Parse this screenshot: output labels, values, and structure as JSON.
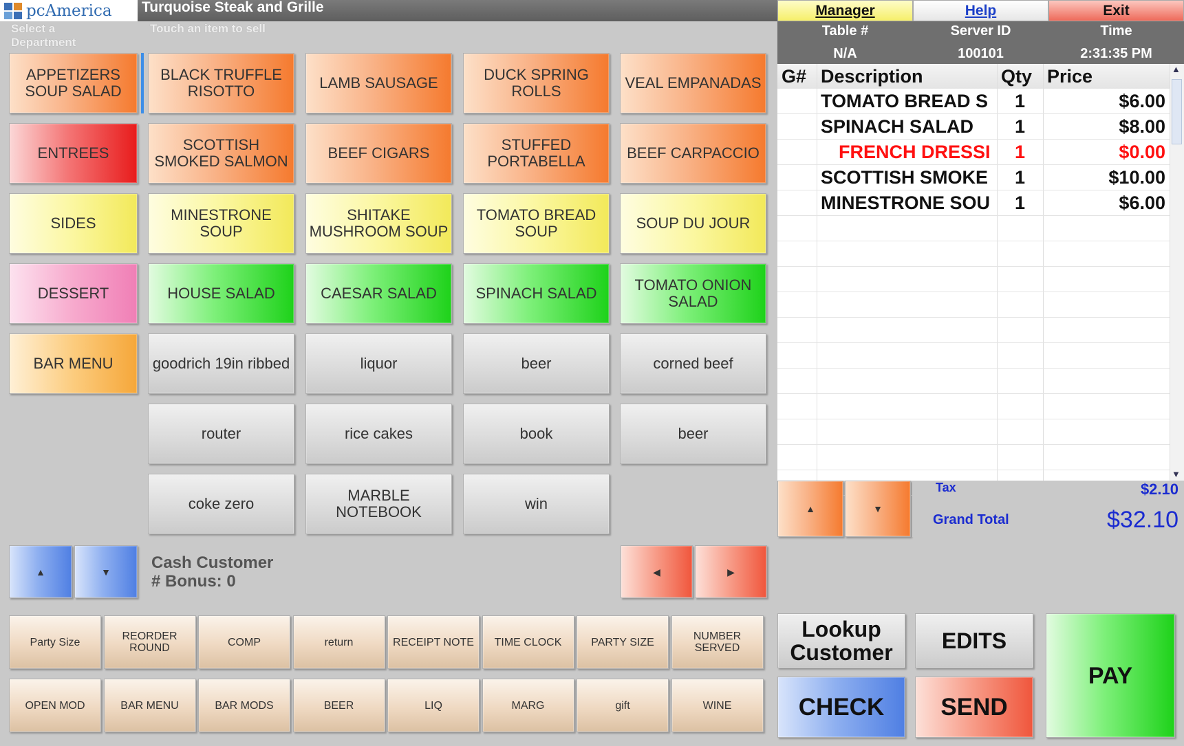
{
  "header": {
    "logo_text": "pcAmerica",
    "app_title": "Turquoise Steak and Grille",
    "dept_hint": "Select a Department",
    "item_hint": "Touch an item to sell"
  },
  "top_menu": {
    "manager": "Manager",
    "help": "Help",
    "exit": "Exit"
  },
  "order_info": {
    "table_label": "Table #",
    "server_label": "Server ID",
    "time_label": "Time",
    "table_value": "N/A",
    "server_value": "100101",
    "time_value": "2:31:35 PM"
  },
  "order_columns": {
    "g": "G#",
    "description": "Description",
    "qty": "Qty",
    "price": "Price"
  },
  "order_rows": [
    {
      "g": "",
      "description": "TOMATO BREAD S",
      "qty": "1",
      "price": "$6.00",
      "modifier": false
    },
    {
      "g": "",
      "description": "SPINACH SALAD",
      "qty": "1",
      "price": "$8.00",
      "modifier": false
    },
    {
      "g": "",
      "description": "FRENCH DRESSI",
      "qty": "1",
      "price": "$0.00",
      "modifier": true
    },
    {
      "g": "",
      "description": "SCOTTISH SMOKE",
      "qty": "1",
      "price": "$10.00",
      "modifier": false
    },
    {
      "g": "",
      "description": "MINESTRONE SOU",
      "qty": "1",
      "price": "$6.00",
      "modifier": false
    }
  ],
  "totals": {
    "tax_label": "Tax",
    "tax_value": "$2.10",
    "grand_label": "Grand Total",
    "grand_value": "$32.10"
  },
  "departments": [
    {
      "label": "APPETIZERS SOUP SALAD",
      "style": "orange"
    },
    {
      "label": "ENTREES",
      "style": "red"
    },
    {
      "label": "SIDES",
      "style": "yellow"
    },
    {
      "label": "DESSERT",
      "style": "pink"
    },
    {
      "label": "BAR MENU",
      "style": "amber"
    }
  ],
  "items": [
    {
      "label": "BLACK TRUFFLE RISOTTO",
      "style": "orange"
    },
    {
      "label": "LAMB SAUSAGE",
      "style": "orange"
    },
    {
      "label": "DUCK SPRING ROLLS",
      "style": "orange"
    },
    {
      "label": "VEAL EMPANADAS",
      "style": "orange"
    },
    {
      "label": "SCOTTISH SMOKED SALMON",
      "style": "orange"
    },
    {
      "label": "BEEF CIGARS",
      "style": "orange"
    },
    {
      "label": "STUFFED PORTABELLA",
      "style": "orange"
    },
    {
      "label": "BEEF CARPACCIO",
      "style": "orange"
    },
    {
      "label": "MINESTRONE SOUP",
      "style": "yellow"
    },
    {
      "label": "SHITAKE MUSHROOM SOUP",
      "style": "yellow"
    },
    {
      "label": "TOMATO BREAD SOUP",
      "style": "yellow"
    },
    {
      "label": "SOUP DU JOUR",
      "style": "yellow"
    },
    {
      "label": "HOUSE SALAD",
      "style": "green"
    },
    {
      "label": "CAESAR SALAD",
      "style": "green"
    },
    {
      "label": "SPINACH SALAD",
      "style": "green"
    },
    {
      "label": "TOMATO ONION SALAD",
      "style": "green"
    },
    {
      "label": "goodrich 19in ribbed",
      "style": "gray"
    },
    {
      "label": "liquor",
      "style": "gray"
    },
    {
      "label": "beer",
      "style": "gray"
    },
    {
      "label": "corned beef",
      "style": "gray"
    },
    {
      "label": "router",
      "style": "gray"
    },
    {
      "label": "rice cakes",
      "style": "gray"
    },
    {
      "label": "book",
      "style": "gray"
    },
    {
      "label": "beer",
      "style": "gray"
    },
    {
      "label": "coke zero",
      "style": "gray"
    },
    {
      "label": "MARBLE NOTEBOOK",
      "style": "gray"
    },
    {
      "label": "win",
      "style": "gray"
    }
  ],
  "customer": {
    "name": "Cash Customer",
    "bonus": "# Bonus: 0"
  },
  "function_row1": [
    "Party Size",
    "REORDER ROUND",
    "COMP",
    "return",
    "RECEIPT NOTE",
    "TIME CLOCK",
    "PARTY SIZE",
    "NUMBER SERVED"
  ],
  "function_row2": [
    "OPEN MOD",
    "BAR MENU",
    "BAR MODS",
    "BEER",
    "LIQ",
    "MARG",
    "gift",
    "WINE"
  ],
  "actions": {
    "lookup": "Lookup Customer",
    "edits": "EDITS",
    "pay": "PAY",
    "check": "CHECK",
    "send": "SEND"
  },
  "icons": {
    "up": "triangle-up",
    "down": "triangle-down",
    "left": "triangle-left",
    "right": "triangle-right"
  },
  "colors": {
    "modifier_text": "#ff1010",
    "total_text": "#1a2bd0",
    "manager_bg": "#fbf8a0",
    "exit_bg": "#f27c6e"
  }
}
